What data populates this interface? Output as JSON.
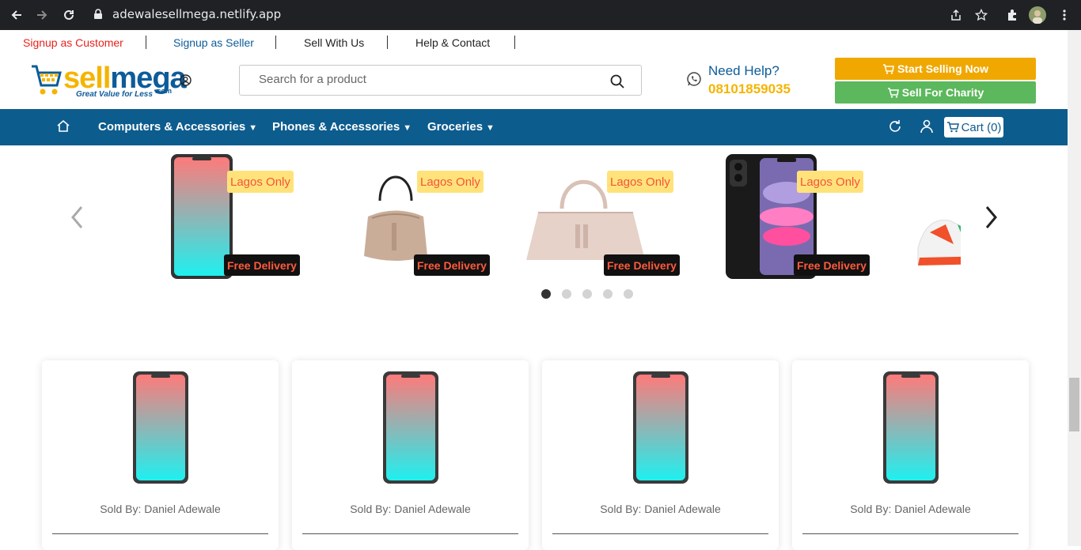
{
  "browser": {
    "url": "adewalesellmega.netlify.app"
  },
  "toplinks": {
    "customer": "Signup as Customer",
    "seller": "Signup as Seller",
    "sell_with_us": "Sell With Us",
    "help_contact": "Help & Contact"
  },
  "header": {
    "logo_sell": "sell",
    "logo_mega": "mega",
    "logo_tagline": "Great Value for Less",
    "logo_com": ".com",
    "search_placeholder": "Search for a product",
    "help_title": "Need Help?",
    "help_phone": "08101859035",
    "start_selling": "Start Selling Now",
    "sell_charity": "Sell For Charity"
  },
  "nav": {
    "items": [
      {
        "label": "Computers & Accessories"
      },
      {
        "label": "Phones & Accessories"
      },
      {
        "label": "Groceries"
      }
    ],
    "cart_label": "Cart (0)"
  },
  "carousel": {
    "slides": [
      {
        "badge_top": "Lagos Only",
        "badge_bottom": "Free Delivery",
        "product": "phone"
      },
      {
        "badge_top": "Lagos Only",
        "badge_bottom": "Free Delivery",
        "product": "bucket bag"
      },
      {
        "badge_top": "Lagos Only",
        "badge_bottom": "Free Delivery",
        "product": "handbag"
      },
      {
        "badge_top": "Lagos Only",
        "badge_bottom": "Free Delivery",
        "product": "iphone"
      }
    ],
    "active_dot": 1,
    "dot_count": 5
  },
  "products": [
    {
      "seller": "Sold By: Daniel Adewale"
    },
    {
      "seller": "Sold By: Daniel Adewale"
    },
    {
      "seller": "Sold By: Daniel Adewale"
    },
    {
      "seller": "Sold By: Daniel Adewale"
    }
  ],
  "colors": {
    "brand_blue": "#0d5c8e",
    "brand_yellow": "#f5b400",
    "link_red": "#e53935",
    "charity_green": "#5cb85c"
  }
}
